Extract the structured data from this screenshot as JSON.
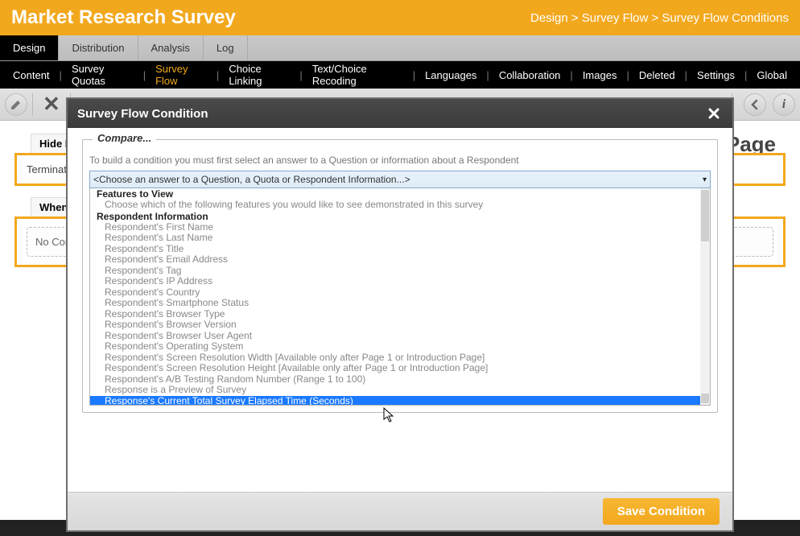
{
  "banner": {
    "title": "Market Research Survey",
    "breadcrumb": "Design > Survey Flow > Survey Flow Conditions"
  },
  "tabs": [
    "Design",
    "Distribution",
    "Analysis",
    "Log"
  ],
  "active_tab": "Design",
  "subnav": [
    "Content",
    "Survey Quotas",
    "Survey Flow",
    "Choice Linking",
    "Text/Choice Recoding",
    "Languages",
    "Collaboration",
    "Images",
    "Deleted",
    "Settings",
    "Global"
  ],
  "active_subnav": "Survey Flow",
  "page_heading_suffix": "y Page",
  "block1": {
    "head": "Hide I",
    "body": "Terminate S"
  },
  "block2": {
    "head": "When",
    "body": "No Conditi"
  },
  "modal": {
    "title": "Survey Flow Condition",
    "legend": "Compare...",
    "hint": "To build a condition you must first select an answer to a Question or information about a Respondent",
    "select_placeholder": "<Choose an answer to a Question, a Quota or Respondent Information...>",
    "group1": "Features to View",
    "group1_item": "Choose which of the following features you would like to see demonstrated in this survey",
    "group2": "Respondent Information",
    "items": [
      "Respondent's First Name",
      "Respondent's Last Name",
      "Respondent's Title",
      "Respondent's Email Address",
      "Respondent's Tag",
      "Respondent's IP Address",
      "Respondent's Country",
      "Respondent's Smartphone Status",
      "Respondent's Browser Type",
      "Respondent's Browser Version",
      "Respondent's Browser User Agent",
      "Respondent's Operating System",
      "Respondent's Screen Resolution Width [Available only after Page 1 or Introduction Page]",
      "Respondent's Screen Resolution Height [Available only after Page 1 or Introduction Page]",
      "Respondent's A/B Testing Random Number (Range 1 to 100)",
      "Response is a Preview of Survey",
      "Response's Current Total Survey Elapsed Time (Seconds)"
    ],
    "selected_index": 16,
    "save_label": "Save Condition"
  }
}
